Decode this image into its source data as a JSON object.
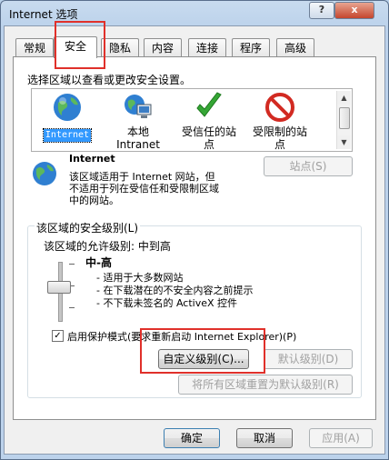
{
  "window": {
    "title": "Internet 选项",
    "help_btn": "?",
    "close_btn": "x"
  },
  "tabs": [
    "常规",
    "安全",
    "隐私",
    "内容",
    "连接",
    "程序",
    "高级"
  ],
  "active_tab": "安全",
  "zones": {
    "prompt": "选择区域以查看或更改安全设置。",
    "items": [
      {
        "label": "Internet",
        "icon": "globe-icon",
        "selected": true
      },
      {
        "label": "本地\nIntranet",
        "icon": "intranet-icon",
        "selected": false
      },
      {
        "label": "受信任的站\n点",
        "icon": "checkmark-icon",
        "selected": false
      },
      {
        "label": "受限制的站\n点",
        "icon": "no-entry-icon",
        "selected": false
      }
    ]
  },
  "zone_info": {
    "title": "Internet",
    "desc_line1": "该区域适用于 Internet 网站，但",
    "desc_line2": "不适用于列在受信任和受限制区域",
    "desc_line3": "中的网站。",
    "sites_button": "站点(S)"
  },
  "security_level": {
    "group_title": "该区域的安全级别(L)",
    "allowed_levels": "该区域的允许级别: 中到高",
    "current_level": "中-高",
    "desc1": "- 适用于大多数网站",
    "desc2": "- 在下载潜在的不安全内容之前提示",
    "desc3": "- 不下载未签名的 ActiveX 控件",
    "protected_mode_label": "启用保护模式(要求重新启动 Internet Explorer)(P)",
    "protected_mode_checked": true,
    "custom_level_button": "自定义级别(C)...",
    "default_level_button": "默认级别(D)",
    "reset_all_button": "将所有区域重置为默认级别(R)"
  },
  "footer": {
    "ok": "确定",
    "cancel": "取消",
    "apply": "应用(A)"
  },
  "colors": {
    "highlight": "#e0302a",
    "selection": "#3399ff"
  }
}
